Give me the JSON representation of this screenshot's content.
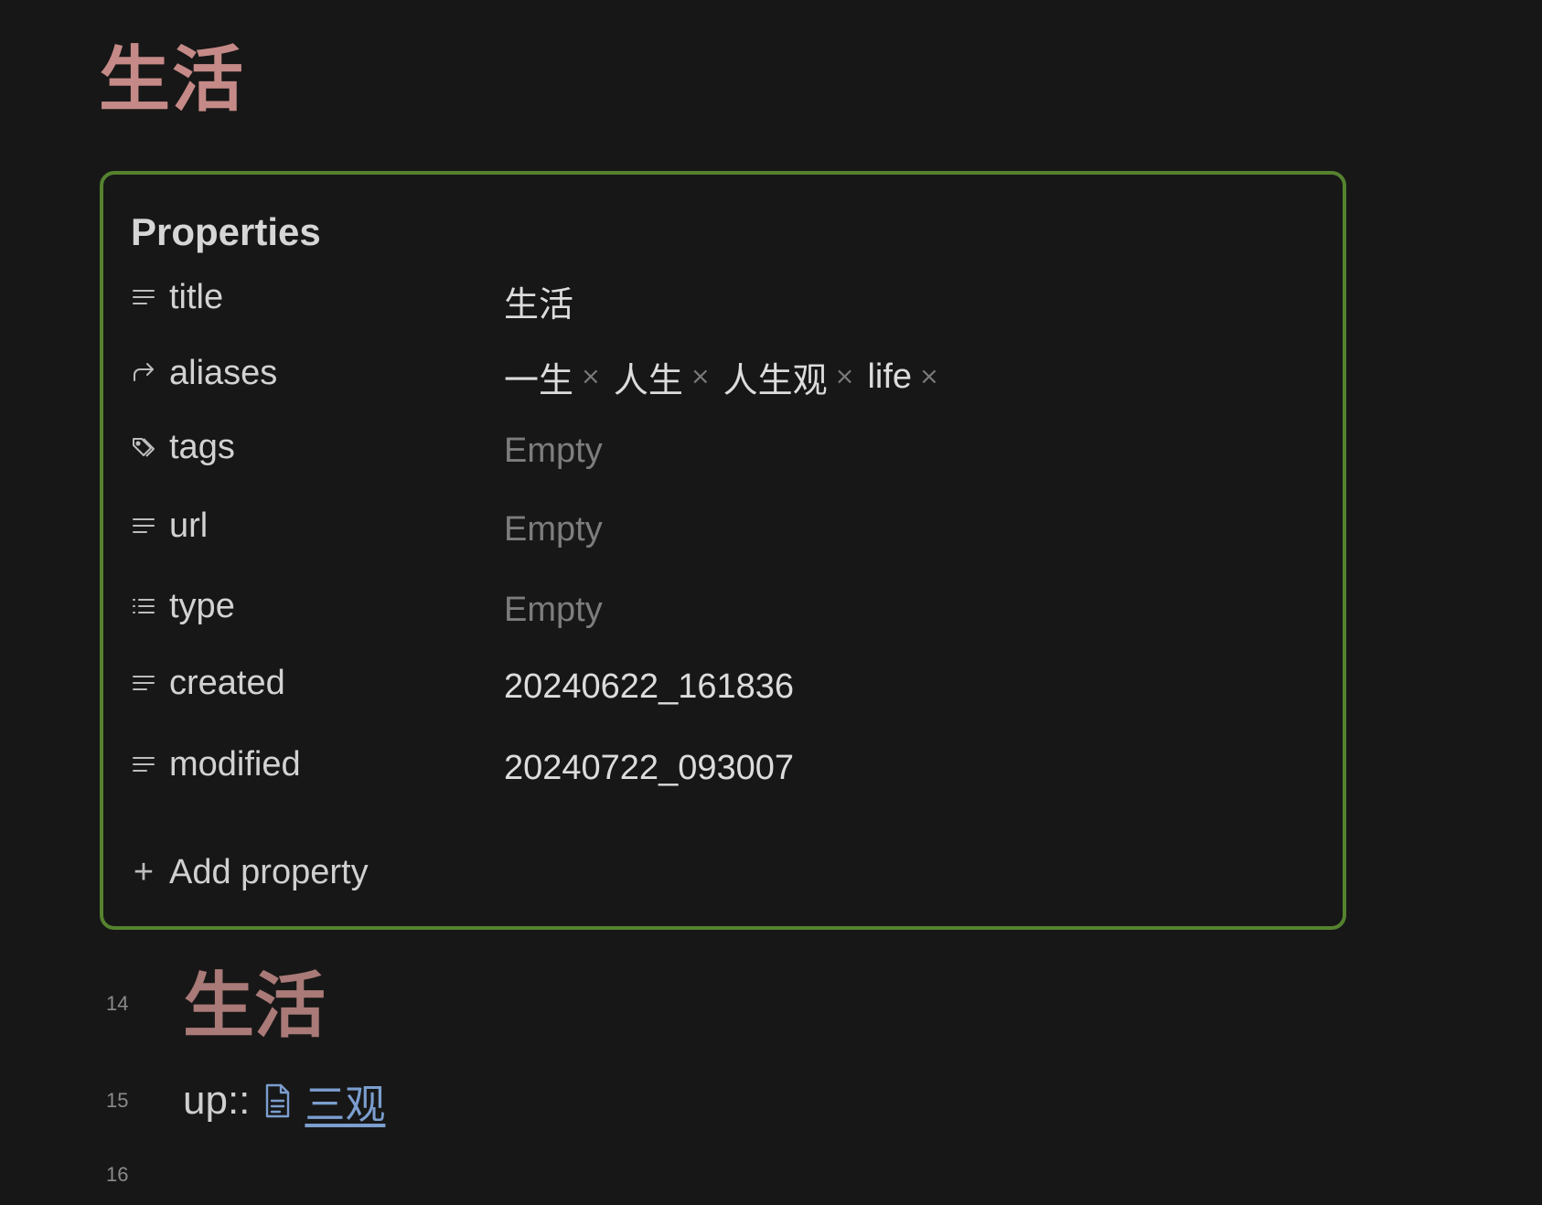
{
  "note": {
    "inline_title": "生活"
  },
  "properties": {
    "heading": "Properties",
    "rows": [
      {
        "key": "title",
        "icon": "text-lines-icon",
        "value": "生活",
        "empty": false
      },
      {
        "key": "aliases",
        "icon": "alias-arrow-icon",
        "values": [
          "一生",
          "人生",
          "人生观",
          "life"
        ]
      },
      {
        "key": "tags",
        "icon": "tags-icon",
        "value": "Empty",
        "empty": true
      },
      {
        "key": "url",
        "icon": "text-lines-icon",
        "value": "Empty",
        "empty": true
      },
      {
        "key": "type",
        "icon": "list-icon",
        "value": "Empty",
        "empty": true
      },
      {
        "key": "created",
        "icon": "text-lines-icon",
        "value": "20240622_161836",
        "empty": false
      },
      {
        "key": "modified",
        "icon": "text-lines-icon",
        "value": "20240722_093007",
        "empty": false
      }
    ],
    "remove_glyph": "×",
    "add_label": "Add property",
    "add_glyph": "+"
  },
  "editor": {
    "lines": [
      {
        "number": "14",
        "heading": "生活"
      },
      {
        "number": "15",
        "prefix": "up::",
        "link_text": "三观",
        "link_icon": "document-icon"
      },
      {
        "number": "16"
      }
    ]
  },
  "colors": {
    "background": "#171717",
    "title_color": "#c58a87",
    "frame_border": "#55822f",
    "link_color": "#7b9ecf",
    "empty_color": "#7d7d7d"
  }
}
